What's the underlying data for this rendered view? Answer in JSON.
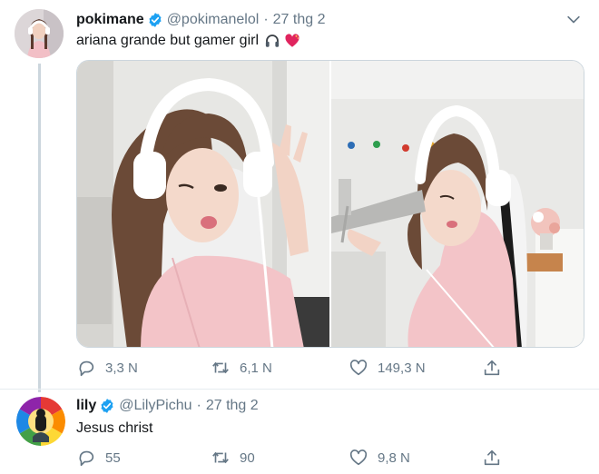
{
  "tweets": [
    {
      "author_name": "pokimane",
      "author_handle": "@pokimanelol",
      "separator": "·",
      "date": "27 thg 2",
      "text": "ariana grande but gamer girl",
      "emojis": [
        "headphones-emoji",
        "heart-emoji"
      ],
      "media": [
        "photo-1",
        "photo-2"
      ],
      "reply_count": "3,3 N",
      "retweet_count": "6,1 N",
      "like_count": "149,3 N"
    },
    {
      "author_name": "lily",
      "author_handle": "@LilyPichu",
      "separator": "·",
      "date": "27 thg 2",
      "text": "Jesus christ",
      "reply_count": "55",
      "retweet_count": "90",
      "like_count": "9,8 N"
    }
  ],
  "colors": {
    "verified": "#1da1f2",
    "secondary_text": "#657786",
    "primary_text": "#14171a",
    "divider": "#e6ecf0",
    "thread_line": "#ccd6dd"
  }
}
